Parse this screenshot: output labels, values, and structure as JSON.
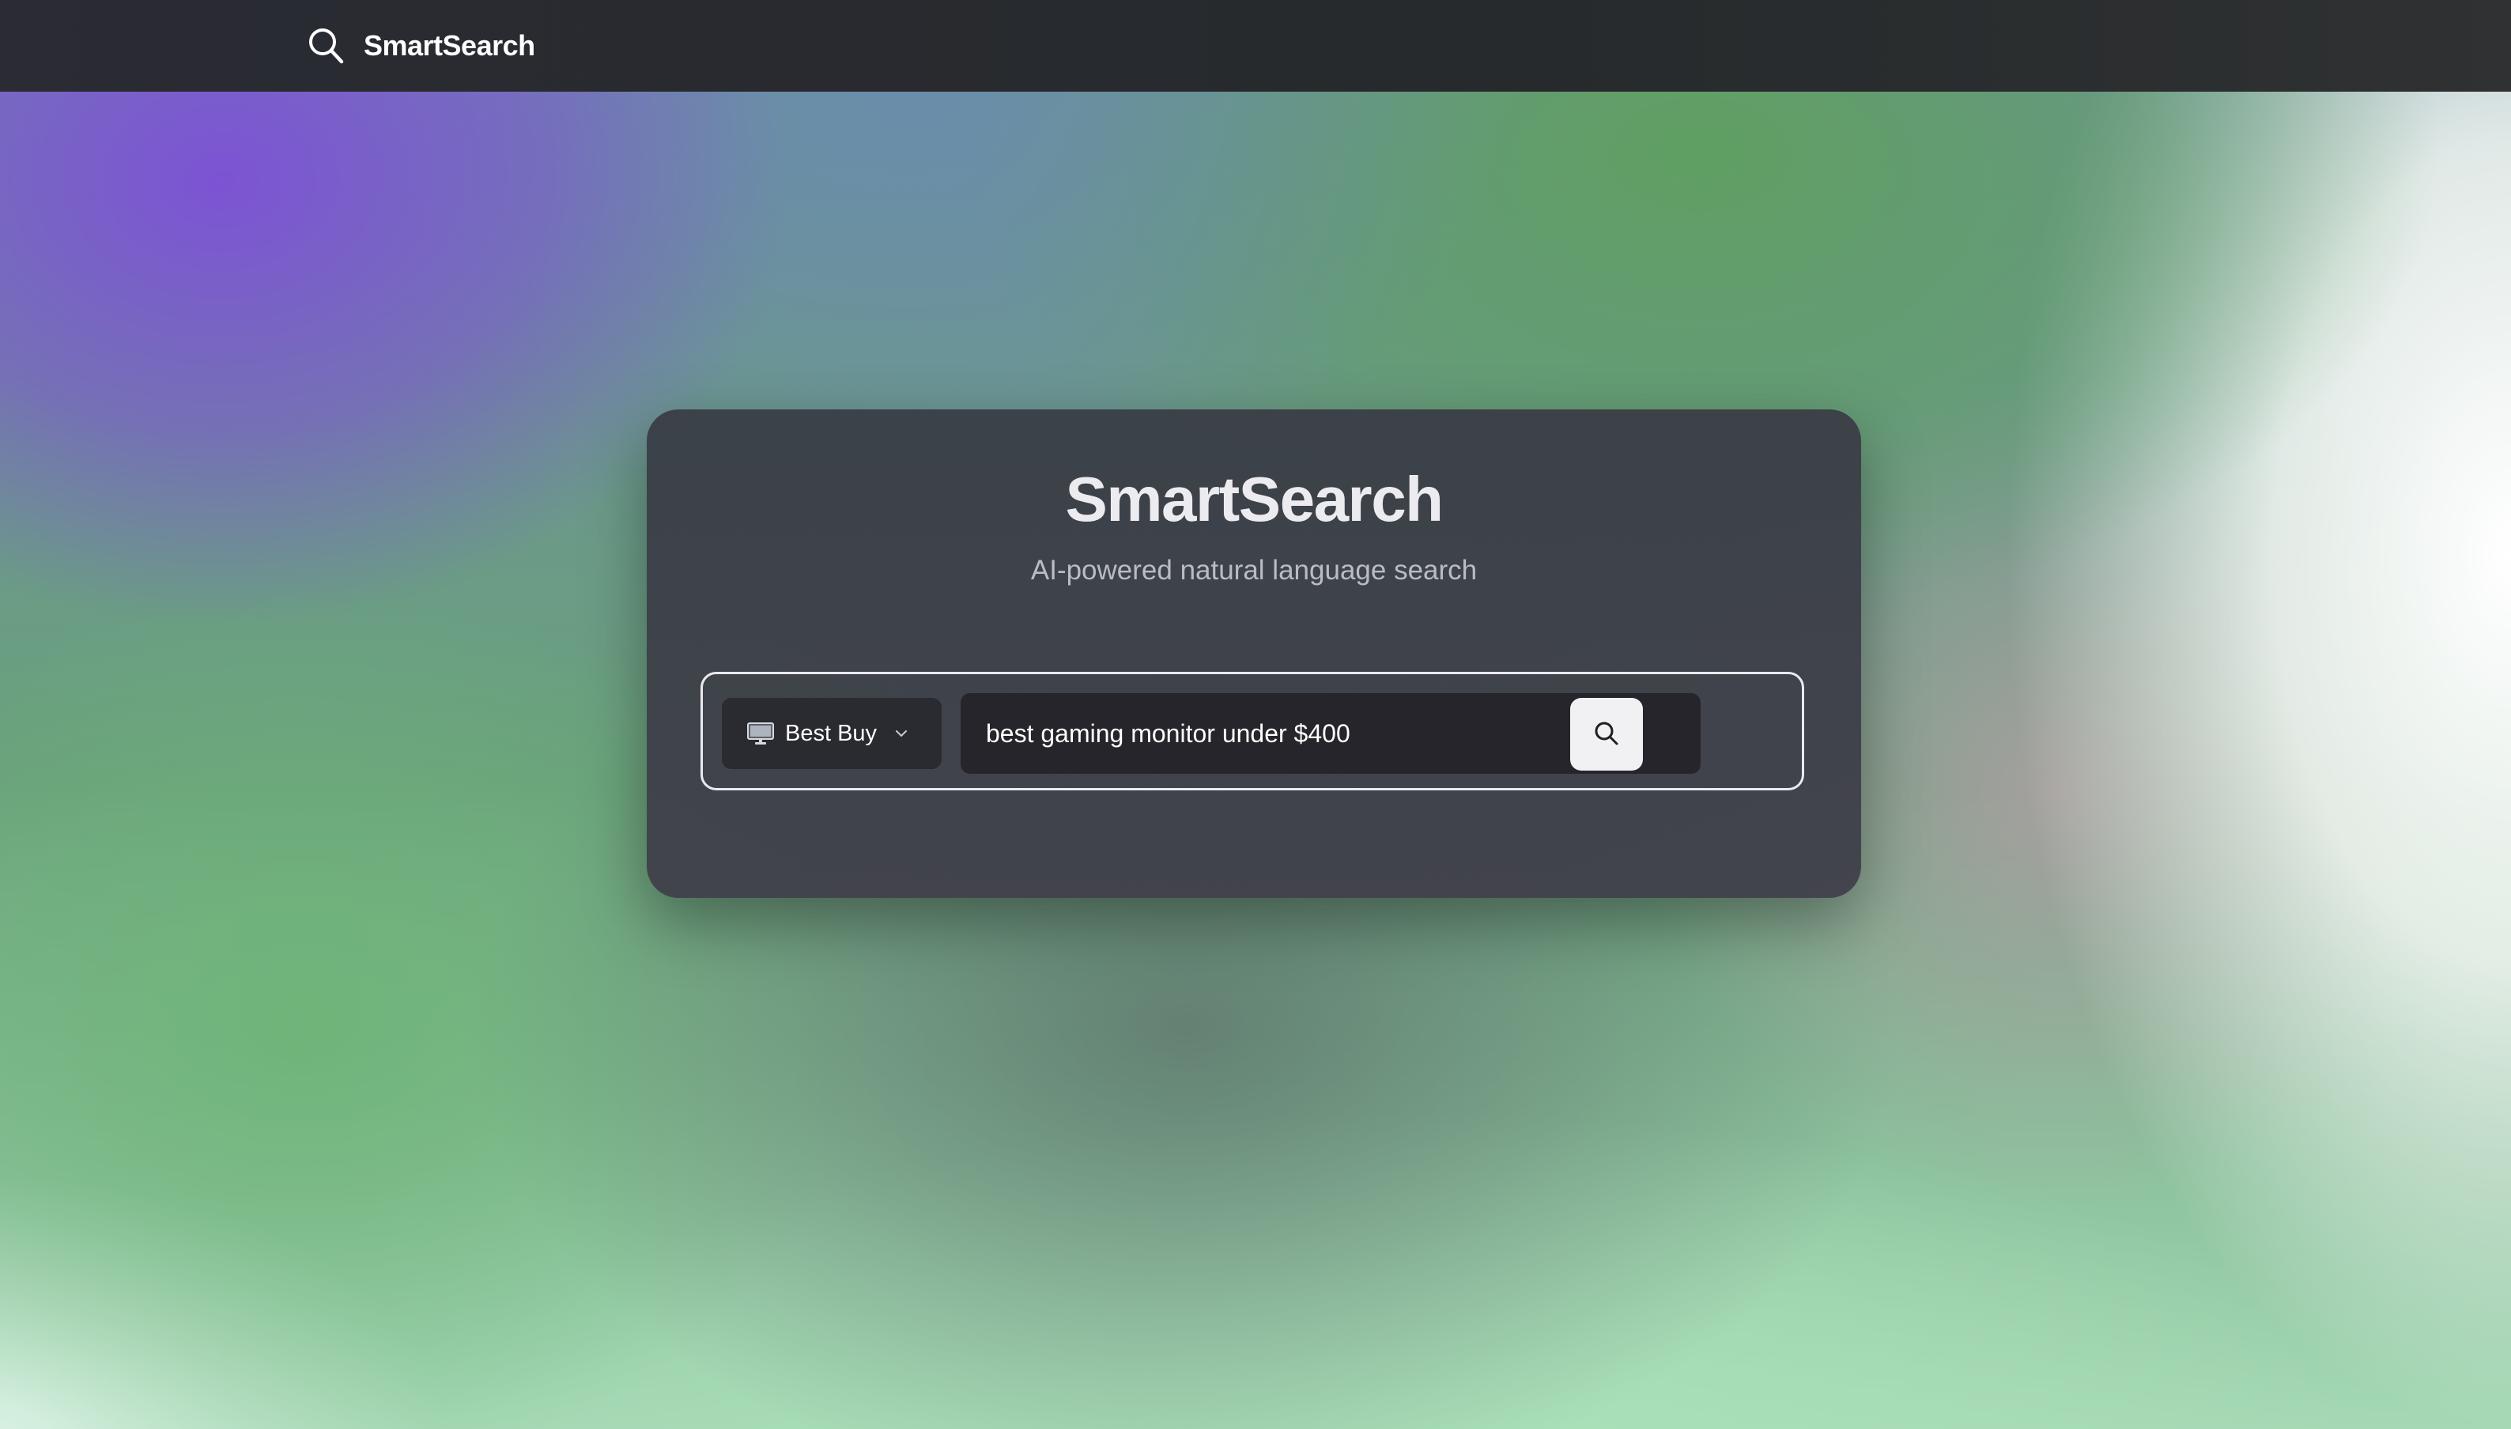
{
  "header": {
    "brand_name": "SmartSearch",
    "brand_icon": "search-icon"
  },
  "hero": {
    "title": "SmartSearch",
    "subtitle": "AI-powered natural language search"
  },
  "search": {
    "site_selector": {
      "selected": "Best Buy",
      "icon": "monitor-icon"
    },
    "query_value": "best gaming monitor under $400",
    "submit_icon": "search-icon"
  },
  "colors": {
    "topbar": "#2a2b33",
    "card": "#3a3e46",
    "input_bg": "#25252b",
    "button_bg": "#f1f1f4"
  }
}
